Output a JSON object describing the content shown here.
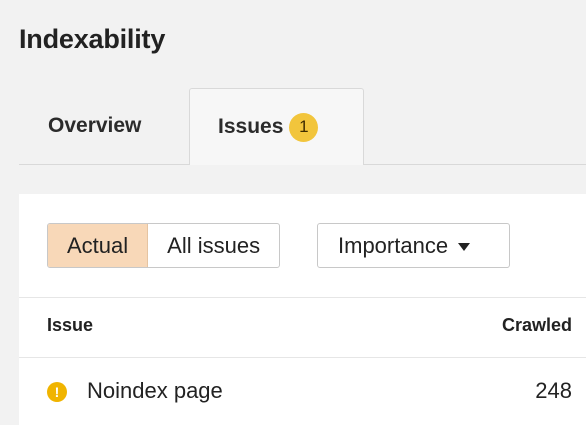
{
  "page": {
    "title": "Indexability"
  },
  "tabs": [
    {
      "label": "Overview"
    },
    {
      "label": "Issues",
      "badge": "1",
      "active": true
    }
  ],
  "filters": {
    "segmented": [
      {
        "label": "Actual",
        "active": true
      },
      {
        "label": "All issues",
        "active": false
      }
    ],
    "sort": {
      "label": "Importance"
    }
  },
  "table": {
    "columns": [
      "Issue",
      "Crawled"
    ],
    "rows": [
      {
        "icon": "warning-icon",
        "issue": "Noindex page",
        "crawled": "248"
      }
    ]
  },
  "colors": {
    "active_filter": "#f8d8b8",
    "badge": "#f2c53c",
    "warning": "#f0b400"
  }
}
